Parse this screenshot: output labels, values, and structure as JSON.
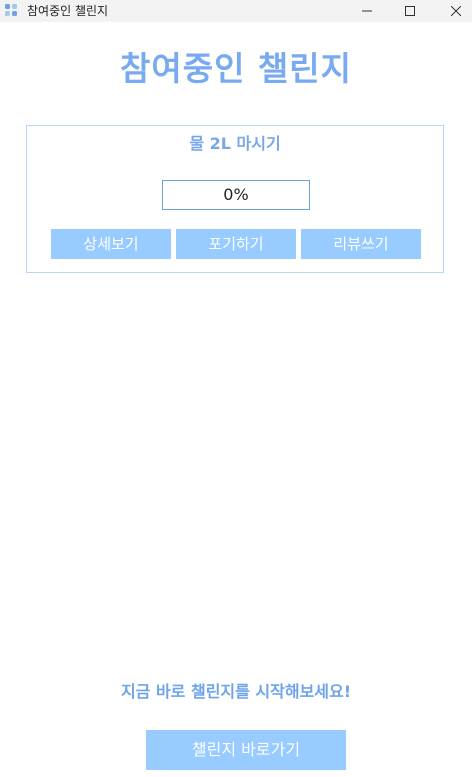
{
  "window": {
    "title": "참여중인 챌린지",
    "icon": "app-icon"
  },
  "page": {
    "title": "참여중인 챌린지"
  },
  "challenge": {
    "name": "물 2L 마시기",
    "progress_label": "0%",
    "progress_value": 0,
    "buttons": {
      "detail": "상세보기",
      "giveup": "포기하기",
      "review": "리뷰쓰기"
    }
  },
  "footer": {
    "cta_text": "지금 바로 챌린지를 시작해보세요!",
    "cta_button": "챌린지 바로가기"
  },
  "colors": {
    "accent": "#77aaf0",
    "button": "#98cbff",
    "card_border": "#b6d8f8"
  }
}
